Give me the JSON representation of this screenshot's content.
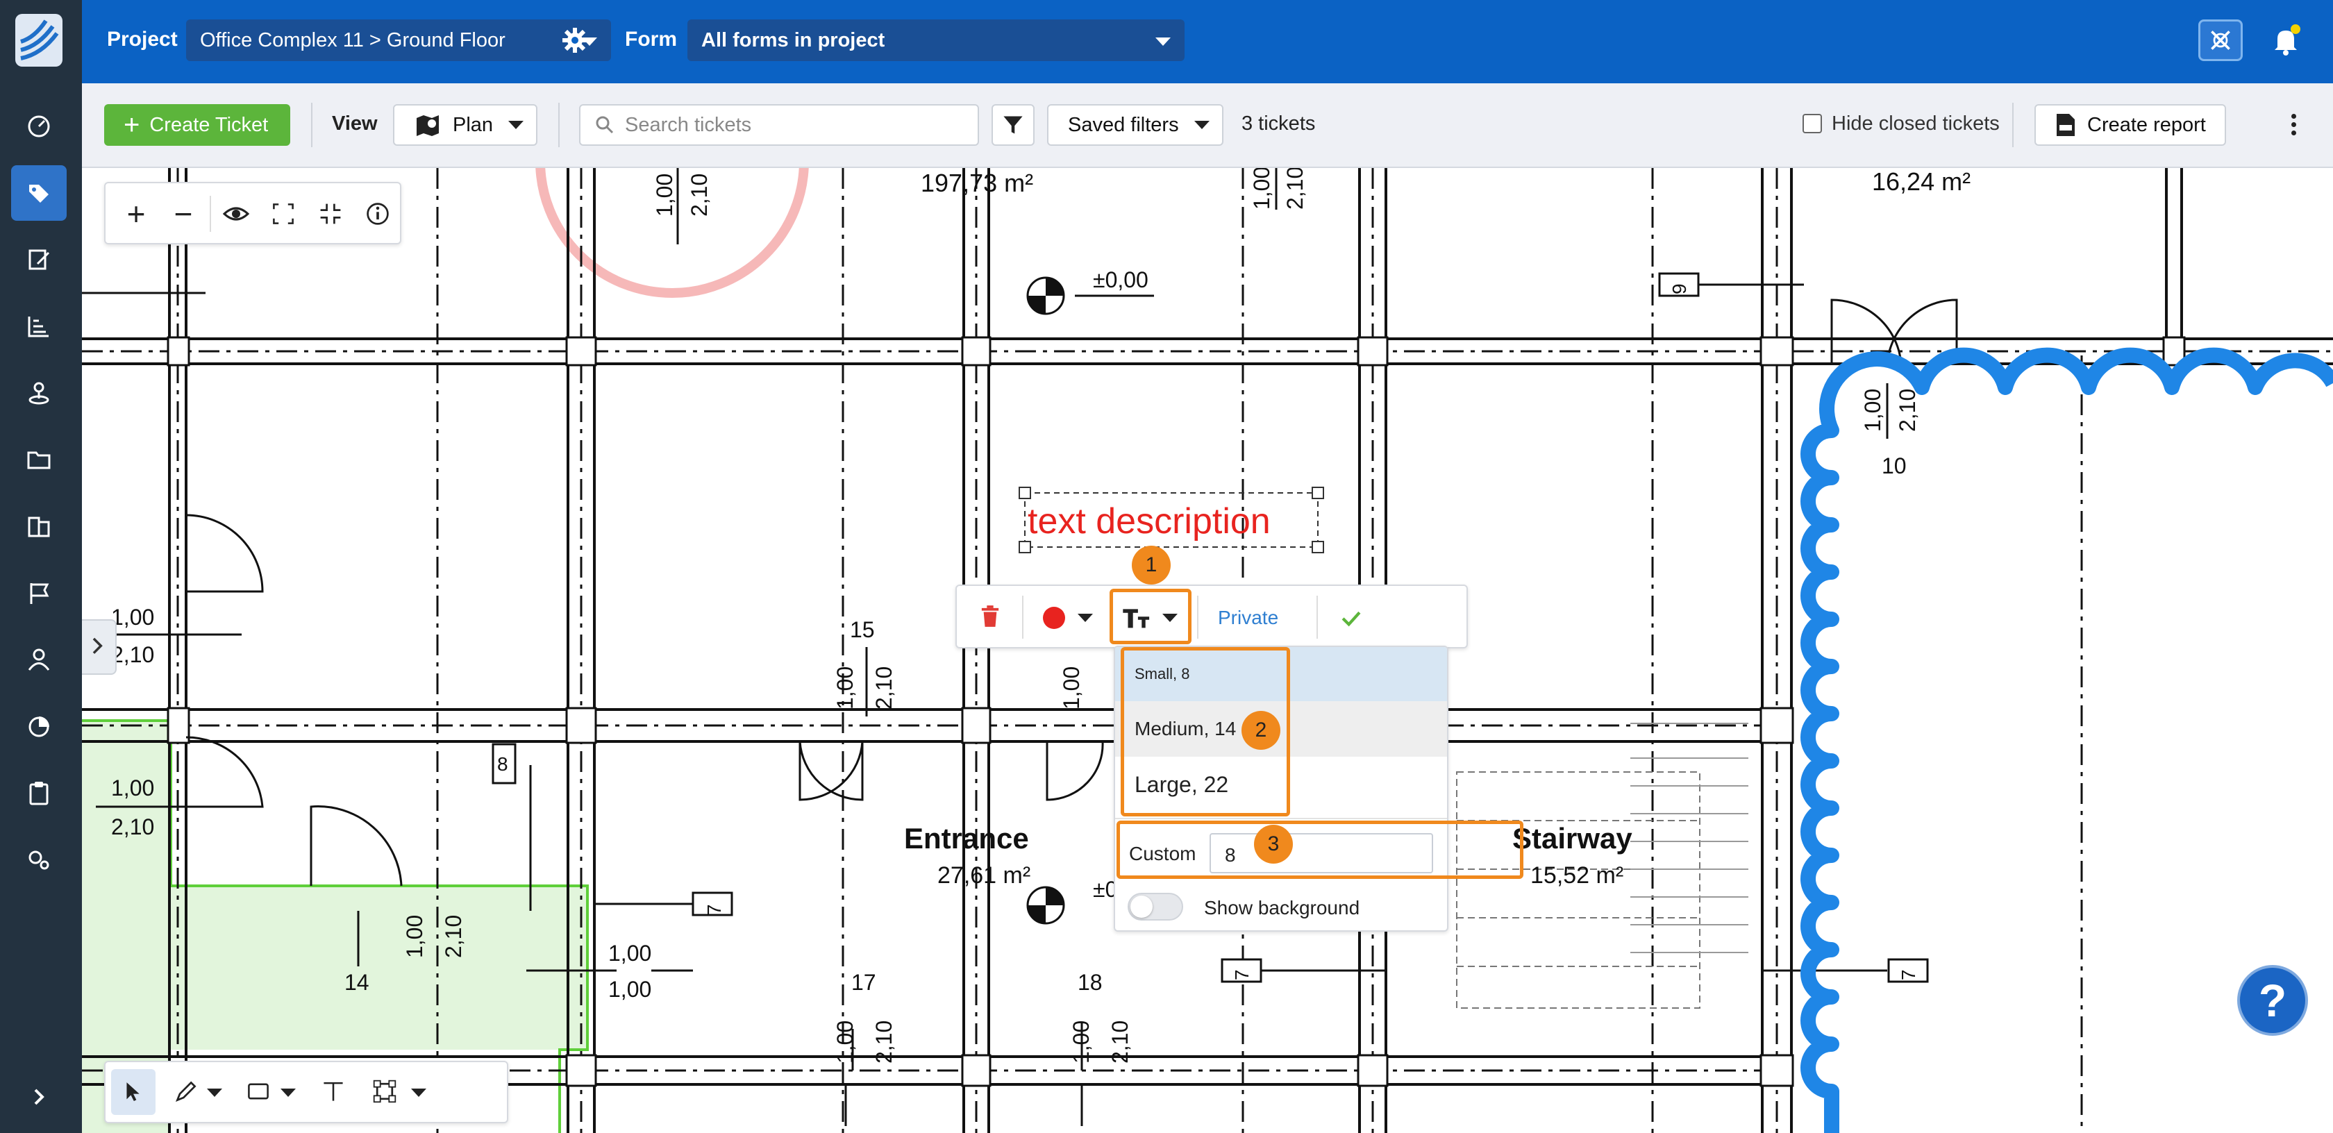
{
  "topbar": {
    "project_label": "Project",
    "project_value": "Office Complex 11 > Ground Floor",
    "form_label": "Form",
    "form_value": "All forms in project"
  },
  "toolbar": {
    "create_ticket": "Create Ticket",
    "view_label": "View",
    "view_value": "Plan",
    "search_placeholder": "Search tickets",
    "saved_filters": "Saved filters",
    "ticket_count": "3 tickets",
    "hide_closed": "Hide closed tickets",
    "create_report": "Create report"
  },
  "plan": {
    "text_annotation": "text description",
    "rooms": [
      {
        "name": "Entrance",
        "area": "27,61 m²"
      },
      {
        "name": "Stairway",
        "area": "15,52 m²"
      }
    ],
    "labels": {
      "area_top_left": "197,73 m²",
      "area_top_right": "16,24 m²",
      "level": "±0,00",
      "level_short": "±0",
      "dim_100": "1,00",
      "dim_210": "2,10",
      "n10": "10",
      "n14": "14",
      "n15": "15",
      "n17": "17",
      "n18": "18",
      "door7": "7",
      "door8": "8",
      "door9": "9"
    }
  },
  "annotation_toolbar": {
    "privacy": "Private",
    "callouts": [
      "1",
      "2",
      "3"
    ]
  },
  "font_size_menu": {
    "options": [
      "Small, 8",
      "Medium, 14",
      "Large, 22"
    ],
    "custom_label": "Custom",
    "custom_value": "8",
    "show_background": "Show background"
  },
  "help": {
    "label": "?"
  },
  "colors": {
    "header": "#0b62c4",
    "rail": "#233240",
    "accent_green": "#5cb53b",
    "annotation_red": "#e8231f",
    "callout_orange": "#f0891d",
    "revision_cloud": "#1f86e6"
  }
}
